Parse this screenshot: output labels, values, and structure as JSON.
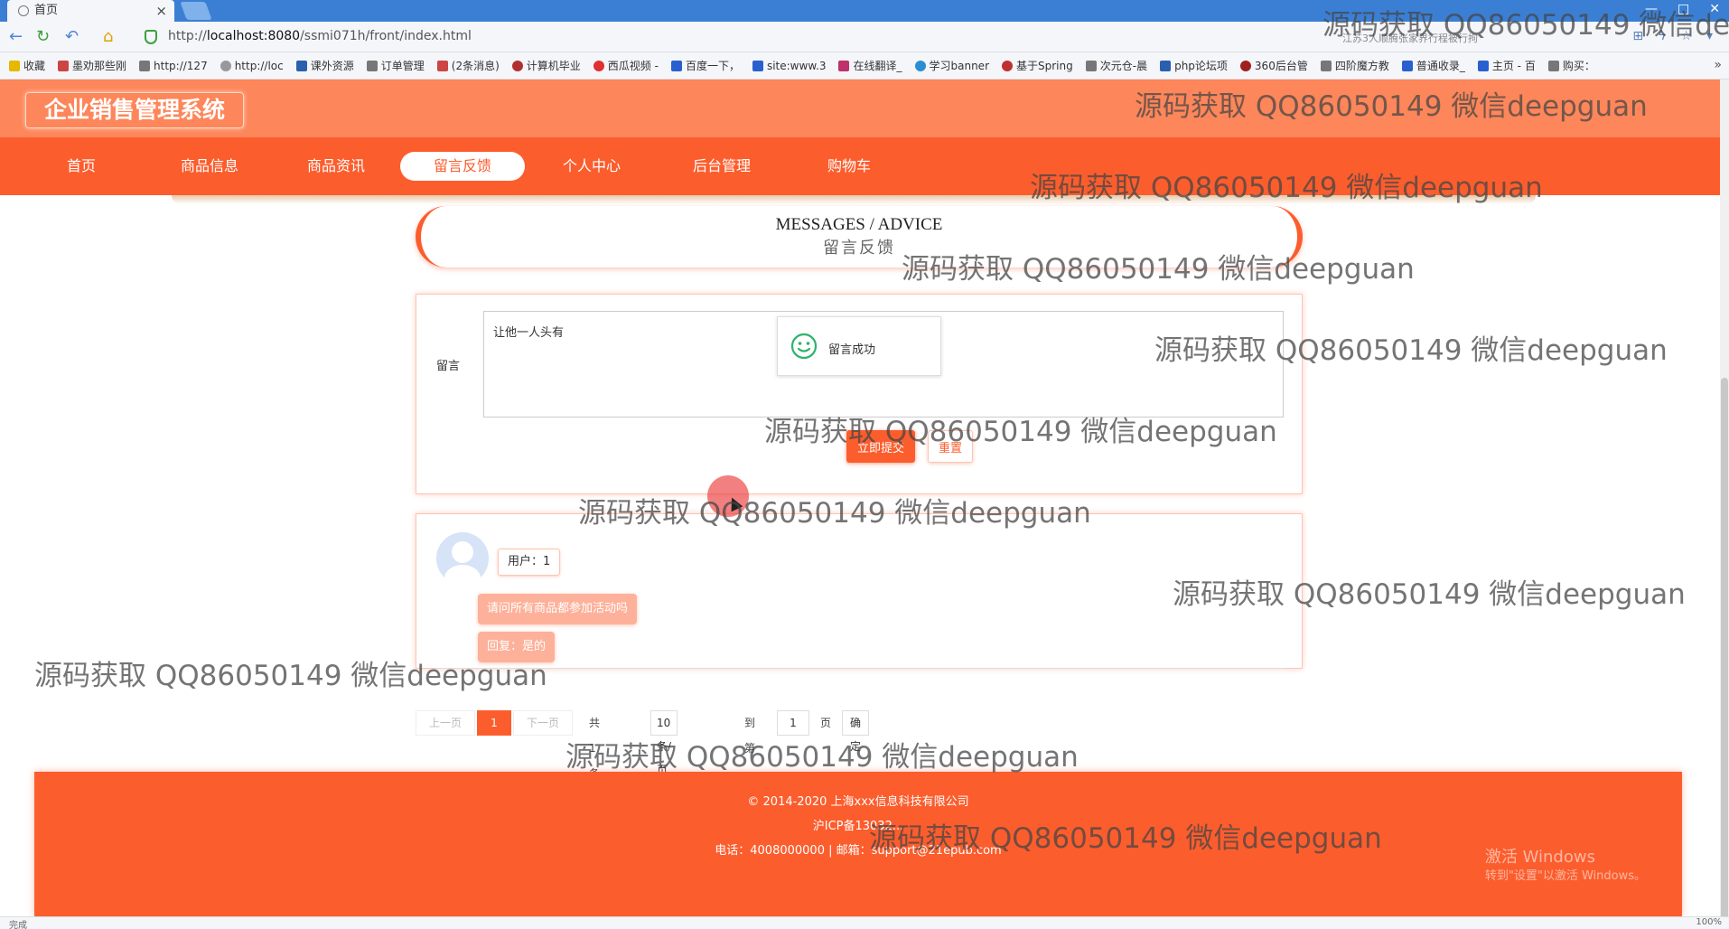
{
  "browser": {
    "tab_title": "首页",
    "tab_close": "×",
    "url_prefix": "http://",
    "url_host": "localhost:8080",
    "url_path": "/ssmi071h/front/index.html",
    "address_hint": "江苏3人顺腾张家界行程被行拘",
    "bookmarks": [
      "收藏",
      "墨劝那些刚",
      "http://127",
      "http://loc",
      "课外资源",
      "订单管理",
      "(2条消息)",
      "计算机毕业",
      "西瓜视频 -",
      "百度一下，",
      "site:www.3",
      "在线翻译_",
      "学习banner",
      "基于Spring",
      "次元仓-晨",
      "php论坛项",
      "360后台管",
      "四阶魔方教",
      "普通收录_",
      "主页 - 百",
      "购买："
    ],
    "bookmarks_more": "»",
    "status_left": "完成",
    "status_right": "100%"
  },
  "site": {
    "logo": "企业销售管理系统",
    "nav": [
      "首页",
      "商品信息",
      "商品资讯",
      "留言反馈",
      "个人中心",
      "后台管理",
      "购物车"
    ],
    "active_nav": "留言反馈"
  },
  "title": {
    "en": "MESSAGES / ADVICE",
    "cn": "留言反馈"
  },
  "form": {
    "label": "留言",
    "value": "让他一人头有",
    "toast": "留言成功",
    "submit": "立即提交",
    "reset": "重置"
  },
  "messages": [
    {
      "user": "用户：1",
      "content": "请问所有商品都参加活动吗",
      "reply": "回复：是的"
    }
  ],
  "pager": {
    "prev": "上一页",
    "current": "1",
    "next": "下一页",
    "total": "共 1 条",
    "per_page": "10 条/页",
    "goto_label": "到第",
    "goto_value": "1",
    "page_unit": "页",
    "confirm": "确定"
  },
  "footer": {
    "copyright": "© 2014-2020 上海xxx信息科技有限公司",
    "icp": "沪ICP备13032...",
    "contact": "电话：4008000000 | 邮箱：support@21epub.com"
  },
  "os": {
    "activate_title": "激活 Windows",
    "activate_hint": "转到\"设置\"以激活 Windows。"
  },
  "watermark": "源码获取 QQ86050149 微信deepguan",
  "colors": {
    "primary": "#fc5d2d",
    "header": "#fd865a",
    "bubble": "#fdb19a"
  }
}
